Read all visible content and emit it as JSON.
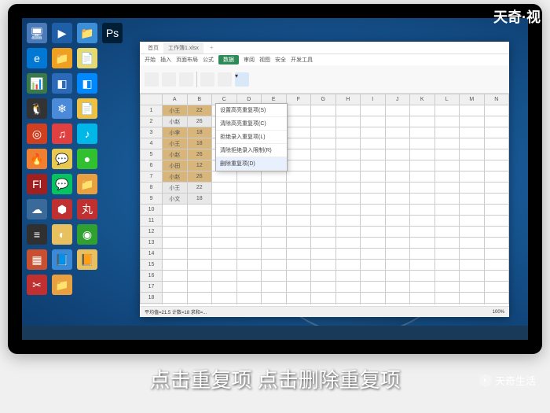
{
  "watermarks": {
    "top": "天奇·视",
    "bottom": "天奇生活"
  },
  "subtitle": "点击重复项 点击删除重复项",
  "spreadsheet": {
    "tabs": [
      "首页",
      "工作簿1.xlsx"
    ],
    "ribbon_tabs": [
      "开始",
      "插入",
      "页面布局",
      "公式",
      "数据",
      "审阅",
      "视图",
      "安全",
      "开发工具"
    ],
    "active_ribbon": "数据",
    "columns": [
      "A",
      "B",
      "C",
      "D",
      "E",
      "F",
      "G",
      "H",
      "I",
      "J",
      "K",
      "L",
      "M",
      "N"
    ],
    "data": [
      {
        "a": "小王",
        "b": "22"
      },
      {
        "a": "小赵",
        "b": "26"
      },
      {
        "a": "小李",
        "b": "18"
      },
      {
        "a": "小王",
        "b": "18"
      },
      {
        "a": "小赵",
        "b": "26"
      },
      {
        "a": "小田",
        "b": "12"
      },
      {
        "a": "小赵",
        "b": "26"
      },
      {
        "a": "小王",
        "b": "22"
      },
      {
        "a": "小文",
        "b": "18"
      }
    ],
    "dropdown": [
      "设置高亮重复项(S)",
      "清除高亮重复项(C)",
      "拒绝录入重复项(L)",
      "清除拒绝录入限制(R)",
      "删除重复项(D)"
    ],
    "status": {
      "left": "平均值=21.5  计数=18  求和=...",
      "zoom": "100%"
    }
  },
  "desktop_icons": [
    {
      "c": "#4a7ab8",
      "g": "🖥"
    },
    {
      "c": "#1e5fa8",
      "g": "▶"
    },
    {
      "c": "#3a8fd8",
      "g": "📁"
    },
    {
      "c": "#001e36",
      "g": "Ps"
    },
    {
      "c": "#0078d4",
      "g": "e"
    },
    {
      "c": "#f0a020",
      "g": "📁"
    },
    {
      "c": "#e8d870",
      "g": "📄"
    },
    {
      "c": "transparent",
      "g": ""
    },
    {
      "c": "#3a7a4a",
      "g": "📊"
    },
    {
      "c": "#2a6ab8",
      "g": "◧"
    },
    {
      "c": "#0088ff",
      "g": "◧"
    },
    {
      "c": "transparent",
      "g": ""
    },
    {
      "c": "#333",
      "g": "🐧"
    },
    {
      "c": "#4a8ad8",
      "g": "❄"
    },
    {
      "c": "#f0c040",
      "g": "📄"
    },
    {
      "c": "transparent",
      "g": ""
    },
    {
      "c": "#d04020",
      "g": "◎"
    },
    {
      "c": "#e04040",
      "g": "♫"
    },
    {
      "c": "#00b8e8",
      "g": "♪"
    },
    {
      "c": "transparent",
      "g": ""
    },
    {
      "c": "#f08030",
      "g": "🔥"
    },
    {
      "c": "#e8c850",
      "g": "💬"
    },
    {
      "c": "#30c030",
      "g": "●"
    },
    {
      "c": "transparent",
      "g": ""
    },
    {
      "c": "#a02020",
      "g": "Fl"
    },
    {
      "c": "#08c160",
      "g": "💬"
    },
    {
      "c": "#e8a040",
      "g": "📁"
    },
    {
      "c": "transparent",
      "g": ""
    },
    {
      "c": "#3a6a9a",
      "g": "☁"
    },
    {
      "c": "#c03030",
      "g": "⬢"
    },
    {
      "c": "#c03030",
      "g": "丸"
    },
    {
      "c": "transparent",
      "g": ""
    },
    {
      "c": "#303030",
      "g": "≡"
    },
    {
      "c": "#e8c060",
      "g": "◐"
    },
    {
      "c": "#30a030",
      "g": "◉"
    },
    {
      "c": "transparent",
      "g": ""
    },
    {
      "c": "#c85030",
      "g": "▦"
    },
    {
      "c": "#3a8ad8",
      "g": "📘"
    },
    {
      "c": "#e8c060",
      "g": "📙"
    },
    {
      "c": "transparent",
      "g": ""
    },
    {
      "c": "#c03030",
      "g": "✂"
    },
    {
      "c": "#e8a040",
      "g": "📁"
    },
    {
      "c": "transparent",
      "g": ""
    },
    {
      "c": "transparent",
      "g": ""
    }
  ]
}
